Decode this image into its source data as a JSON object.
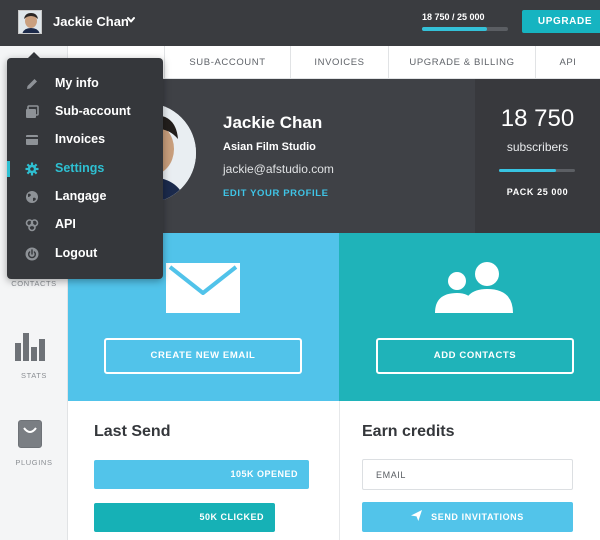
{
  "header": {
    "user_name": "Jackie Chan",
    "quota_text": "18 750 / 25 000",
    "quota_progress": 0.75,
    "upgrade_label": "UPGRADE"
  },
  "tabs": [
    {
      "label": "SUB-ACCOUNT"
    },
    {
      "label": "INVOICES"
    },
    {
      "label": "UPGRADE & BILLING"
    },
    {
      "label": "API"
    }
  ],
  "sidebar": {
    "items": [
      {
        "label": "CONTACTS"
      },
      {
        "label": "STATS",
        "icon": "stats-icon"
      },
      {
        "label": "PLUGINS",
        "icon": "plugins-icon"
      }
    ]
  },
  "user_menu": {
    "items": [
      {
        "label": "My info",
        "icon": "pencil-icon"
      },
      {
        "label": "Sub-account",
        "icon": "sub-account-icon"
      },
      {
        "label": "Invoices",
        "icon": "invoices-icon"
      },
      {
        "label": "Settings",
        "icon": "gear-icon",
        "active": true
      },
      {
        "label": "Langage",
        "icon": "globe-icon"
      },
      {
        "label": "API",
        "icon": "api-icon"
      },
      {
        "label": "Logout",
        "icon": "power-icon"
      }
    ]
  },
  "profile": {
    "name": "Jackie Chan",
    "company": "Asian Film Studio",
    "email": "jackie@afstudio.com",
    "edit_link": "EDIT YOUR PROFILE",
    "subscribers_count": "18 750",
    "subscribers_label": "subscribers",
    "subscribers_progress": 0.75,
    "pack_label": "PACK 25 000"
  },
  "actions": {
    "create_email_label": "CREATE NEW EMAIL",
    "add_contacts_label": "ADD CONTACTS"
  },
  "last_send": {
    "title": "Last Send",
    "opened_label": "105K OPENED",
    "clicked_label": "50K CLICKED"
  },
  "earn_credits": {
    "title": "Earn credits",
    "email_placeholder": "EMAIL",
    "send_label": "SEND INVITATIONS"
  },
  "colors": {
    "accent_teal": "#16b4c1",
    "accent_blue": "#51c3ea",
    "dark_bar": "#3a3c40"
  }
}
